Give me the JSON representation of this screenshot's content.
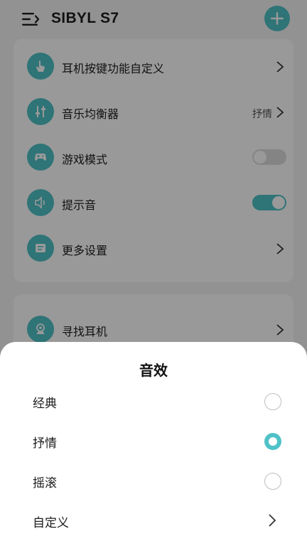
{
  "app": {
    "title": "SIBYL S7",
    "accent_color": "#4fc2c7"
  },
  "settings_card": {
    "items": [
      {
        "label": "耳机按键功能自定义",
        "icon": "hand-tap-icon",
        "control": "chevron"
      },
      {
        "label": "音乐均衡器",
        "icon": "equalizer-icon",
        "control": "chevron",
        "value": "抒情"
      },
      {
        "label": "游戏模式",
        "icon": "gamepad-icon",
        "control": "toggle",
        "on": false
      },
      {
        "label": "提示音",
        "icon": "speaker-icon",
        "control": "toggle",
        "on": true
      },
      {
        "label": "更多设置",
        "icon": "more-settings-icon",
        "control": "chevron"
      }
    ]
  },
  "second_card": {
    "items": [
      {
        "label": "寻找耳机",
        "icon": "locate-earbuds-icon",
        "control": "chevron"
      }
    ]
  },
  "sound_effect_sheet": {
    "title": "音效",
    "options": [
      {
        "label": "经典",
        "selected": false
      },
      {
        "label": "抒情",
        "selected": true
      },
      {
        "label": "摇滚",
        "selected": false
      }
    ],
    "custom_label": "自定义"
  }
}
